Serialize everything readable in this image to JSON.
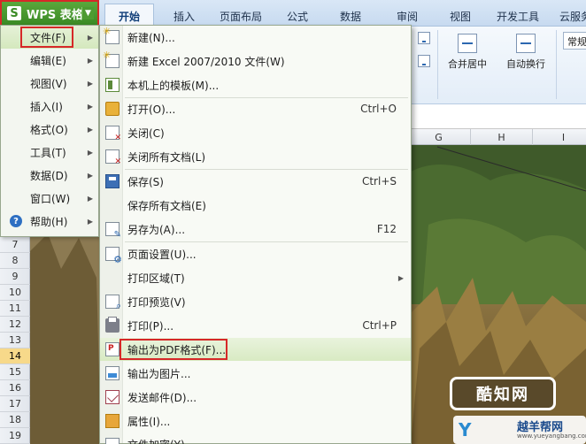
{
  "app": {
    "title": "WPS 表格",
    "logo": "S"
  },
  "tabs": [
    {
      "label": "开始"
    },
    {
      "label": "插入"
    },
    {
      "label": "页面布局"
    },
    {
      "label": "公式"
    },
    {
      "label": "数据"
    },
    {
      "label": "审阅"
    },
    {
      "label": "视图"
    },
    {
      "label": "开发工具"
    },
    {
      "label": "云服务"
    }
  ],
  "ribbon": {
    "merge_label": "合并居中",
    "wrap_label": "自动换行",
    "format_label": "常规"
  },
  "columns": [
    "G",
    "H",
    "I"
  ],
  "rows": [
    "7",
    "8",
    "9",
    "10",
    "11",
    "12",
    "13",
    "14",
    "15",
    "16",
    "17",
    "18",
    "19"
  ],
  "selected_row": "14",
  "main_menu": [
    {
      "label": "文件(F)",
      "icon": "none"
    },
    {
      "label": "编辑(E)",
      "icon": "none"
    },
    {
      "label": "视图(V)",
      "icon": "none"
    },
    {
      "label": "插入(I)",
      "icon": "none"
    },
    {
      "label": "格式(O)",
      "icon": "none"
    },
    {
      "label": "工具(T)",
      "icon": "none"
    },
    {
      "label": "数据(D)",
      "icon": "none"
    },
    {
      "label": "窗口(W)",
      "icon": "none"
    },
    {
      "label": "帮助(H)",
      "icon": "help-icon",
      "icon_glyph": "?"
    }
  ],
  "file_menu": [
    {
      "label": "新建(N)...",
      "shortcut": "",
      "icon": "new-icon"
    },
    {
      "label": "新建 Excel 2007/2010 文件(W)",
      "shortcut": "",
      "icon": "new-excel-icon"
    },
    {
      "label": "本机上的模板(M)...",
      "shortcut": "",
      "icon": "template-icon"
    },
    {
      "label": "打开(O)...",
      "shortcut": "Ctrl+O",
      "icon": "open-folder-icon"
    },
    {
      "label": "关闭(C)",
      "shortcut": "",
      "icon": "close-doc-icon"
    },
    {
      "label": "关闭所有文档(L)",
      "shortcut": "",
      "icon": "close-all-icon"
    },
    {
      "label": "保存(S)",
      "shortcut": "Ctrl+S",
      "icon": "save-icon"
    },
    {
      "label": "保存所有文档(E)",
      "shortcut": "",
      "icon": "none"
    },
    {
      "label": "另存为(A)...",
      "shortcut": "F12",
      "icon": "save-as-icon"
    },
    {
      "label": "页面设置(U)...",
      "shortcut": "",
      "icon": "page-setup-icon"
    },
    {
      "label": "打印区域(T)",
      "shortcut": "",
      "icon": "none"
    },
    {
      "label": "打印预览(V)",
      "shortcut": "",
      "icon": "print-preview-icon"
    },
    {
      "label": "打印(P)...",
      "shortcut": "Ctrl+P",
      "icon": "printer-icon"
    },
    {
      "label": "输出为PDF格式(F)...",
      "shortcut": "",
      "icon": "pdf-icon"
    },
    {
      "label": "输出为图片...",
      "shortcut": "",
      "icon": "image-icon"
    },
    {
      "label": "发送邮件(D)...",
      "shortcut": "",
      "icon": "mail-icon"
    },
    {
      "label": "属性(I)...",
      "shortcut": "",
      "icon": "properties-icon"
    },
    {
      "label": "文件加密(Y)...",
      "shortcut": "",
      "icon": "encrypt-icon"
    }
  ],
  "watermark": {
    "badge_text": "酷知网",
    "site_name": "越羊帮网",
    "site_url": "www.yueyangbang.com"
  }
}
